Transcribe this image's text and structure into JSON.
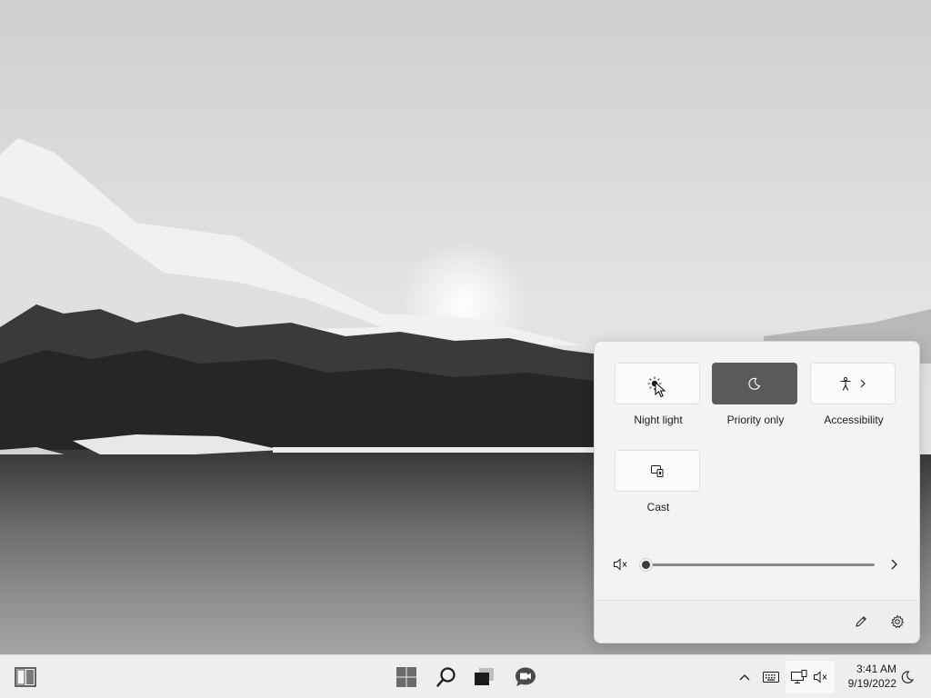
{
  "quick_settings": {
    "tiles": [
      {
        "label": "Night light",
        "icon": "brightness-icon",
        "active": false
      },
      {
        "label": "Priority only",
        "icon": "moon-icon",
        "active": true
      },
      {
        "label": "Accessibility",
        "icon": "accessibility-icon",
        "active": false,
        "has_chevron": true
      },
      {
        "label": "Cast",
        "icon": "cast-icon",
        "active": false
      }
    ],
    "volume": {
      "level_percent": 0,
      "muted": true
    },
    "footer": {
      "edit_icon": "pencil-icon",
      "settings_icon": "gear-icon"
    }
  },
  "taskbar": {
    "widgets_icon": "widgets-icon",
    "start_icon": "windows-logo-icon",
    "search_icon": "search-icon",
    "task_view_icon": "task-view-icon",
    "chat_icon": "chat-icon",
    "tray": {
      "overflow_icon": "chevron-up-icon",
      "keyboard_icon": "keyboard-icon",
      "network_icon": "network-icon",
      "volume_icon": "volume-muted-icon",
      "focus_icon": "moon-icon"
    },
    "clock": {
      "time": "3:41 AM",
      "date": "9/19/2022"
    }
  }
}
